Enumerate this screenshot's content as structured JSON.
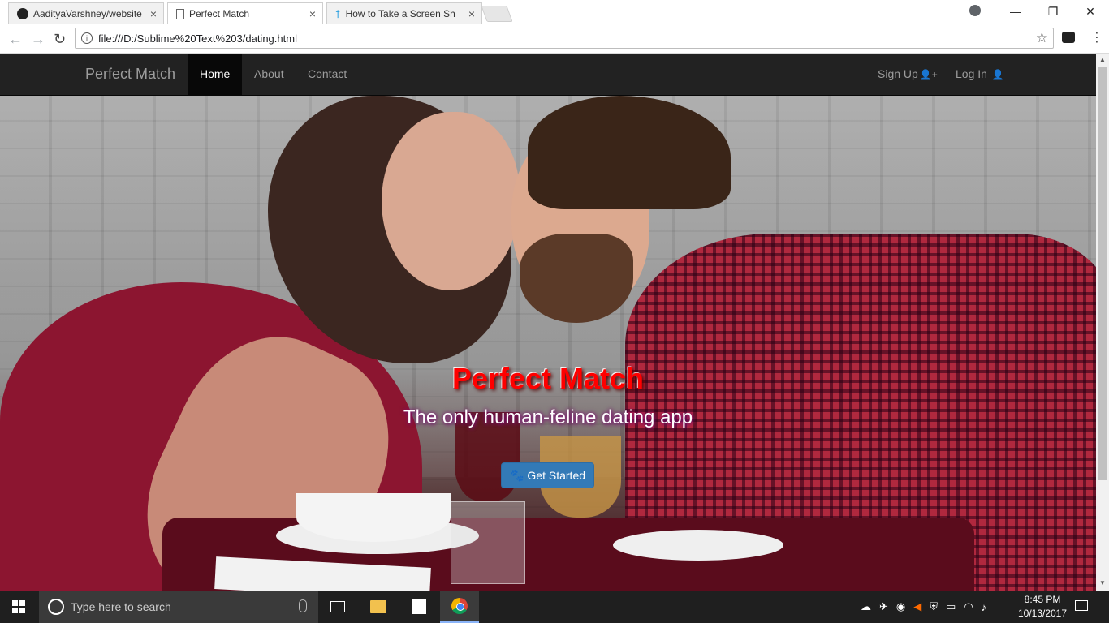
{
  "browser": {
    "tabs": [
      {
        "title": "AadityaVarshney/website",
        "icon": "github-icon",
        "active": false
      },
      {
        "title": "Perfect Match",
        "icon": "page-icon",
        "active": true
      },
      {
        "title": "How to Take a Screen Sh",
        "icon": "upload-arrow-icon",
        "active": false
      }
    ],
    "close_glyph": "×",
    "address": "file:///D:/Sublime%20Text%203/dating.html",
    "window_controls": {
      "minimize": "—",
      "maximize": "❐",
      "close": "✕"
    }
  },
  "navbar": {
    "brand": "Perfect Match",
    "items": [
      {
        "label": "Home",
        "active": true
      },
      {
        "label": "About",
        "active": false
      },
      {
        "label": "Contact",
        "active": false
      }
    ],
    "signup": "Sign Up",
    "login": "Log In"
  },
  "hero": {
    "title": "Perfect Match",
    "subtitle": "The only human-feline dating app",
    "button": "Get Started",
    "colors": {
      "title": "#ff0000",
      "button": "#337ab7"
    }
  },
  "taskbar": {
    "search_placeholder": "Type here to search",
    "time": "8:45 PM",
    "date": "10/13/2017"
  }
}
